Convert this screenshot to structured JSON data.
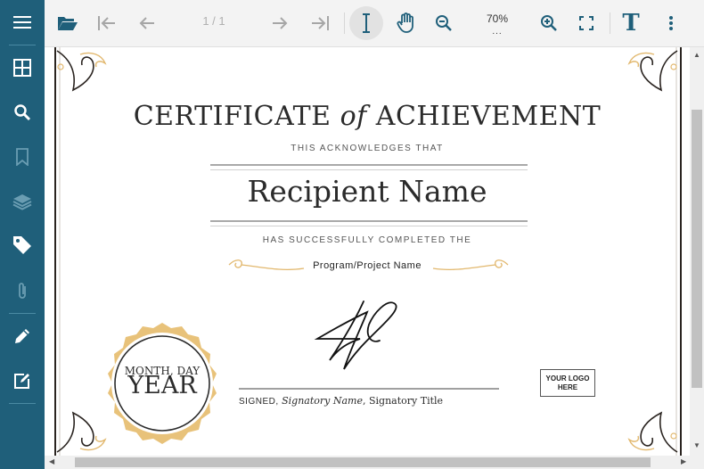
{
  "sidebar": {
    "items": [
      {
        "icon": "menu-icon"
      },
      {
        "icon": "thumbnails-icon"
      },
      {
        "icon": "search-icon"
      },
      {
        "icon": "bookmark-icon"
      },
      {
        "icon": "layers-icon"
      },
      {
        "icon": "tag-icon"
      },
      {
        "icon": "paperclip-icon"
      },
      {
        "icon": "pencil-icon"
      },
      {
        "icon": "edit-form-icon"
      }
    ]
  },
  "toolbar": {
    "page_indicator": "1 / 1",
    "zoom_level": "70%",
    "zoom_more": "...",
    "text_tool_label": "T"
  },
  "certificate": {
    "title_main": "CERTIFICATE",
    "title_of": "of",
    "title_end": "ACHIEVEMENT",
    "acknowledges": "THIS ACKNOWLEDGES THAT",
    "recipient": "Recipient Name",
    "completed": "HAS SUCCESSFULLY COMPLETED THE",
    "program": "Program/Project Name",
    "signed_label": "SIGNED,",
    "signatory_name": "Signatory Name",
    "signatory_title": "Signatory Title",
    "seal_month_day": "MONTH, DAY",
    "seal_year": "YEAR",
    "logo_line1": "YOUR LOGO",
    "logo_line2": "HERE"
  },
  "colors": {
    "sidebar_bg": "#1f5f7a",
    "toolbar_bg": "#f3f3f3",
    "gold": "#e8c27a",
    "ink": "#2b2b2b"
  }
}
